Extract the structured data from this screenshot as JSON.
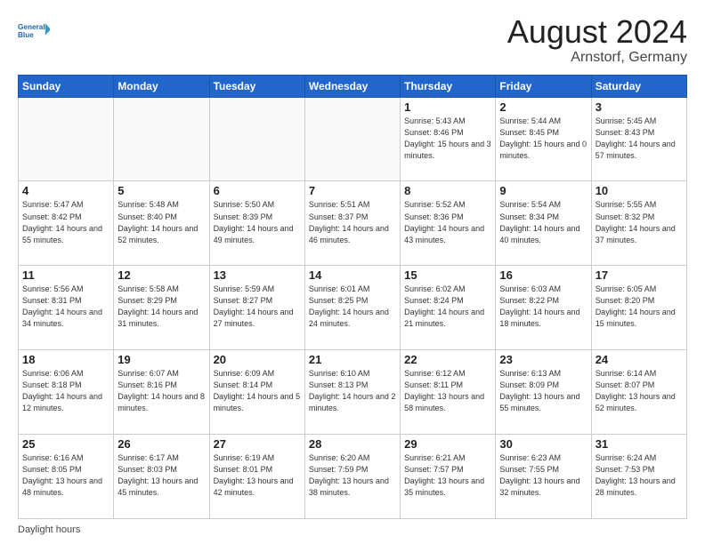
{
  "logo": {
    "line1": "General",
    "line2": "Blue"
  },
  "title": "August 2024",
  "location": "Arnstorf, Germany",
  "days_of_week": [
    "Sunday",
    "Monday",
    "Tuesday",
    "Wednesday",
    "Thursday",
    "Friday",
    "Saturday"
  ],
  "weeks": [
    [
      {
        "day": "",
        "info": ""
      },
      {
        "day": "",
        "info": ""
      },
      {
        "day": "",
        "info": ""
      },
      {
        "day": "",
        "info": ""
      },
      {
        "day": "1",
        "info": "Sunrise: 5:43 AM\nSunset: 8:46 PM\nDaylight: 15 hours\nand 3 minutes."
      },
      {
        "day": "2",
        "info": "Sunrise: 5:44 AM\nSunset: 8:45 PM\nDaylight: 15 hours\nand 0 minutes."
      },
      {
        "day": "3",
        "info": "Sunrise: 5:45 AM\nSunset: 8:43 PM\nDaylight: 14 hours\nand 57 minutes."
      }
    ],
    [
      {
        "day": "4",
        "info": "Sunrise: 5:47 AM\nSunset: 8:42 PM\nDaylight: 14 hours\nand 55 minutes."
      },
      {
        "day": "5",
        "info": "Sunrise: 5:48 AM\nSunset: 8:40 PM\nDaylight: 14 hours\nand 52 minutes."
      },
      {
        "day": "6",
        "info": "Sunrise: 5:50 AM\nSunset: 8:39 PM\nDaylight: 14 hours\nand 49 minutes."
      },
      {
        "day": "7",
        "info": "Sunrise: 5:51 AM\nSunset: 8:37 PM\nDaylight: 14 hours\nand 46 minutes."
      },
      {
        "day": "8",
        "info": "Sunrise: 5:52 AM\nSunset: 8:36 PM\nDaylight: 14 hours\nand 43 minutes."
      },
      {
        "day": "9",
        "info": "Sunrise: 5:54 AM\nSunset: 8:34 PM\nDaylight: 14 hours\nand 40 minutes."
      },
      {
        "day": "10",
        "info": "Sunrise: 5:55 AM\nSunset: 8:32 PM\nDaylight: 14 hours\nand 37 minutes."
      }
    ],
    [
      {
        "day": "11",
        "info": "Sunrise: 5:56 AM\nSunset: 8:31 PM\nDaylight: 14 hours\nand 34 minutes."
      },
      {
        "day": "12",
        "info": "Sunrise: 5:58 AM\nSunset: 8:29 PM\nDaylight: 14 hours\nand 31 minutes."
      },
      {
        "day": "13",
        "info": "Sunrise: 5:59 AM\nSunset: 8:27 PM\nDaylight: 14 hours\nand 27 minutes."
      },
      {
        "day": "14",
        "info": "Sunrise: 6:01 AM\nSunset: 8:25 PM\nDaylight: 14 hours\nand 24 minutes."
      },
      {
        "day": "15",
        "info": "Sunrise: 6:02 AM\nSunset: 8:24 PM\nDaylight: 14 hours\nand 21 minutes."
      },
      {
        "day": "16",
        "info": "Sunrise: 6:03 AM\nSunset: 8:22 PM\nDaylight: 14 hours\nand 18 minutes."
      },
      {
        "day": "17",
        "info": "Sunrise: 6:05 AM\nSunset: 8:20 PM\nDaylight: 14 hours\nand 15 minutes."
      }
    ],
    [
      {
        "day": "18",
        "info": "Sunrise: 6:06 AM\nSunset: 8:18 PM\nDaylight: 14 hours\nand 12 minutes."
      },
      {
        "day": "19",
        "info": "Sunrise: 6:07 AM\nSunset: 8:16 PM\nDaylight: 14 hours\nand 8 minutes."
      },
      {
        "day": "20",
        "info": "Sunrise: 6:09 AM\nSunset: 8:14 PM\nDaylight: 14 hours\nand 5 minutes."
      },
      {
        "day": "21",
        "info": "Sunrise: 6:10 AM\nSunset: 8:13 PM\nDaylight: 14 hours\nand 2 minutes."
      },
      {
        "day": "22",
        "info": "Sunrise: 6:12 AM\nSunset: 8:11 PM\nDaylight: 13 hours\nand 58 minutes."
      },
      {
        "day": "23",
        "info": "Sunrise: 6:13 AM\nSunset: 8:09 PM\nDaylight: 13 hours\nand 55 minutes."
      },
      {
        "day": "24",
        "info": "Sunrise: 6:14 AM\nSunset: 8:07 PM\nDaylight: 13 hours\nand 52 minutes."
      }
    ],
    [
      {
        "day": "25",
        "info": "Sunrise: 6:16 AM\nSunset: 8:05 PM\nDaylight: 13 hours\nand 48 minutes."
      },
      {
        "day": "26",
        "info": "Sunrise: 6:17 AM\nSunset: 8:03 PM\nDaylight: 13 hours\nand 45 minutes."
      },
      {
        "day": "27",
        "info": "Sunrise: 6:19 AM\nSunset: 8:01 PM\nDaylight: 13 hours\nand 42 minutes."
      },
      {
        "day": "28",
        "info": "Sunrise: 6:20 AM\nSunset: 7:59 PM\nDaylight: 13 hours\nand 38 minutes."
      },
      {
        "day": "29",
        "info": "Sunrise: 6:21 AM\nSunset: 7:57 PM\nDaylight: 13 hours\nand 35 minutes."
      },
      {
        "day": "30",
        "info": "Sunrise: 6:23 AM\nSunset: 7:55 PM\nDaylight: 13 hours\nand 32 minutes."
      },
      {
        "day": "31",
        "info": "Sunrise: 6:24 AM\nSunset: 7:53 PM\nDaylight: 13 hours\nand 28 minutes."
      }
    ]
  ],
  "footer": "Daylight hours"
}
